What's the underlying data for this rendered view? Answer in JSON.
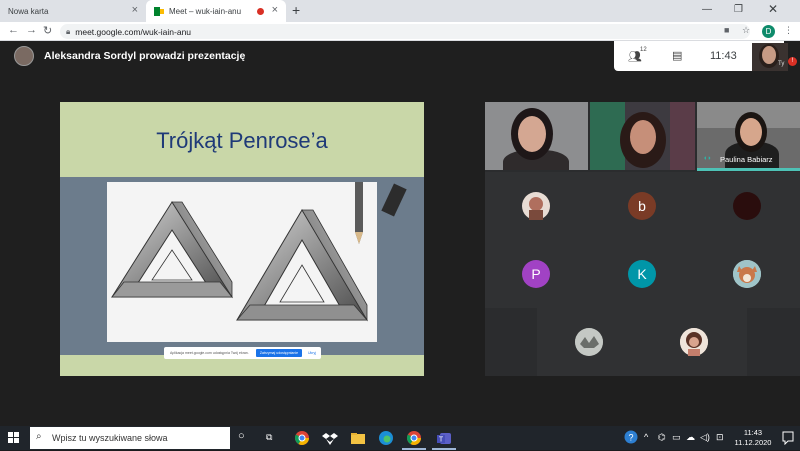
{
  "browser": {
    "tabs": [
      {
        "title": "Nowa karta",
        "active": false
      },
      {
        "title": "Meet – wuk-iain-anu",
        "active": true
      }
    ],
    "url": "meet.google.com/wuk-iain-anu",
    "profile_initial": "D"
  },
  "meet": {
    "presenter_status": "Aleksandra Sordyl prowadzi prezentację",
    "participants_count": "12",
    "time": "11:43",
    "self_label": "Ty",
    "self_badge": "!",
    "slide": {
      "title": "Trójkąt Penrose’a"
    },
    "share_bar": {
      "message": "Aplikacja meet.google.com udostępnia Twój ekran.",
      "stop_label": "Zatrzymaj udostępnianie",
      "hide_label": "Ukryj"
    },
    "speaker_name": "Paulina Babiarz",
    "participant_tiles": [
      {
        "kind": "photo",
        "color": "#b06f5e"
      },
      {
        "kind": "initial",
        "initial": "b",
        "color": "#7a3b26"
      },
      {
        "kind": "photo",
        "color": "#2a0d0d"
      },
      {
        "kind": "initial",
        "initial": "P",
        "color": "#a142c4"
      },
      {
        "kind": "initial",
        "initial": "K",
        "color": "#0096a8"
      },
      {
        "kind": "photo",
        "color": "#9fc4c8"
      },
      {
        "kind": "photo",
        "color": "#8a8f8a"
      },
      {
        "kind": "photo",
        "color": "#c47e6c"
      }
    ]
  },
  "taskbar": {
    "search_placeholder": "Wpisz tu wyszukiwane słowa",
    "clock_time": "11:43",
    "clock_date": "11.12.2020"
  }
}
